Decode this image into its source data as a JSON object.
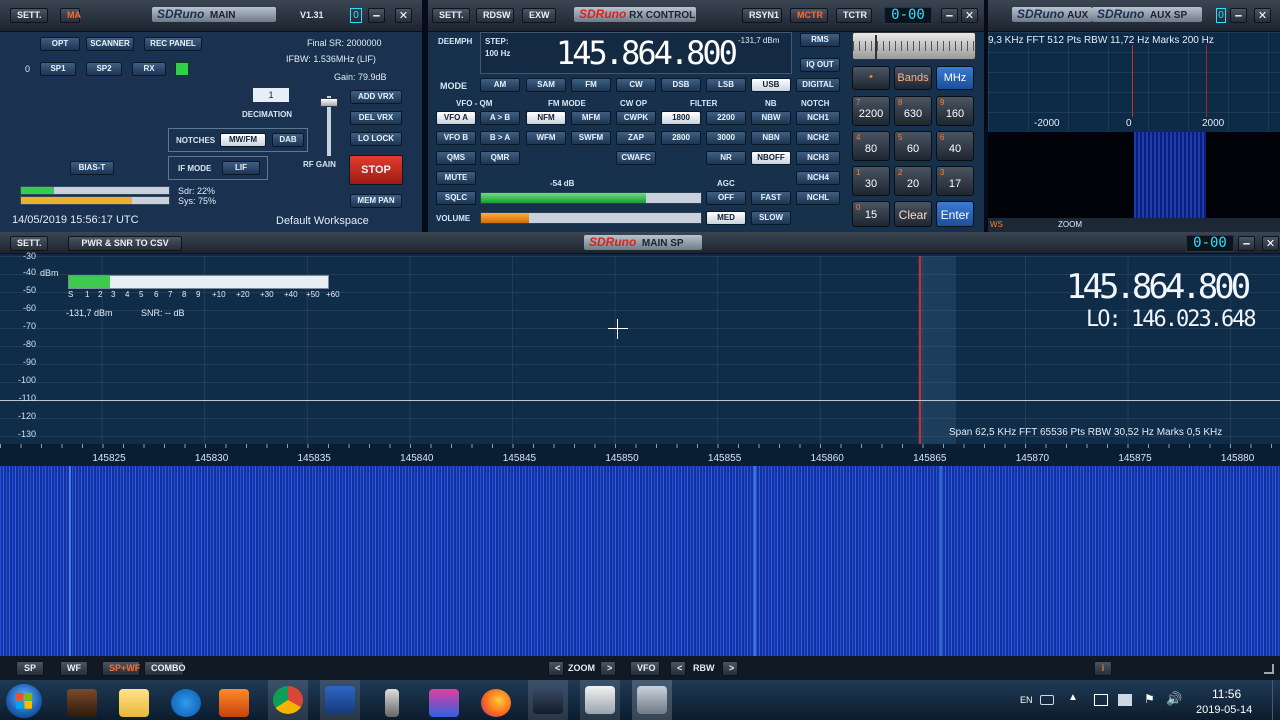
{
  "ma": {
    "sett": "SETT.",
    "ma": "MA",
    "logo": "SDRuno",
    "title": "MAIN",
    "version": "V1.31",
    "buttons": [
      "OPT",
      "SCANNER",
      "REC PANEL"
    ],
    "sp_buttons": [
      "SP1",
      "SP2",
      "RX"
    ],
    "zero": "0",
    "final_sr": "Final SR: 2000000",
    "ifbw": "IFBW: 1.536MHz (LIF)",
    "gain": "Gain: 79.9dB",
    "decimation_value": "1",
    "decimation_label": "DECIMATION",
    "notches": "NOTCHES",
    "mwfm": "MW/FM",
    "dab": "DAB",
    "bias": "BIAS-T",
    "if_mode": "IF MODE",
    "lif": "LIF",
    "rf_gain": "RF GAIN",
    "add_vrx": "ADD VRX",
    "del_vrx": "DEL VRX",
    "lo_lock": "LO LOCK",
    "stop": "STOP",
    "mem_pan": "MEM PAN",
    "sdr": "Sdr: 22%",
    "sys": "Sys: 75%",
    "datetime": "14/05/2019 15:56:17 UTC",
    "workspace": "Default Workspace"
  },
  "rx": {
    "sett": "SETT.",
    "rdsw": "RDSW",
    "exw": "EXW",
    "logo": "SDRuno",
    "title": "RX CONTROL",
    "rsyn": "RSYN1",
    "mctr": "MCTR",
    "tctr": "TCTR",
    "lcd": "0-00",
    "deemph": "DEEMPH",
    "step_label": "STEP:",
    "step_value": "100 Hz",
    "frequency": "145.864.800",
    "level": "-131,7 dBm",
    "rms": "RMS",
    "iq_out": "IQ OUT",
    "mode_label": "MODE",
    "modes": [
      "AM",
      "SAM",
      "FM",
      "CW",
      "DSB",
      "LSB",
      "USB",
      "DIGITAL"
    ],
    "vfo_qm": "VFO - QM",
    "fm_mode": "FM MODE",
    "cw_op": "CW OP",
    "filter": "FILTER",
    "nb": "NB",
    "notch": "NOTCH",
    "row1": [
      "VFO A",
      "A > B",
      "NFM",
      "MFM",
      "CWPK",
      "1800",
      "2200",
      "NBW",
      "NCH1"
    ],
    "row2": [
      "VFO B",
      "B > A",
      "WFM",
      "SWFM",
      "ZAP",
      "2800",
      "3000",
      "NBN",
      "NCH2"
    ],
    "row3": [
      "QMS",
      "QMR",
      "CWAFC",
      "NR",
      "NBOFF",
      "NCH3"
    ],
    "mute": "MUTE",
    "nch4": "NCH4",
    "sqlc": "SQLC",
    "volume": "VOLUME",
    "sql_db": "-54 dB",
    "agc": "AGC",
    "agc_buttons": [
      "OFF",
      "FAST",
      "MED",
      "SLOW"
    ],
    "nchl": "NCHL",
    "sql_level": 0.75,
    "volume_level": 0.22
  },
  "keypad": {
    "bands": "Bands",
    "mhz": "MHz",
    "keys": [
      {
        "n": "7",
        "v": "2200"
      },
      {
        "n": "8",
        "v": "630"
      },
      {
        "n": "9",
        "v": "160"
      },
      {
        "n": "4",
        "v": "80"
      },
      {
        "n": "5",
        "v": "60"
      },
      {
        "n": "6",
        "v": "40"
      },
      {
        "n": "1",
        "v": "30"
      },
      {
        "n": "2",
        "v": "20"
      },
      {
        "n": "3",
        "v": "17"
      },
      {
        "n": "0",
        "v": "15"
      }
    ],
    "clear": "Clear",
    "enter": "Enter"
  },
  "aux": {
    "logo1": "SDRuno",
    "aux1": "AUX",
    "logo2": "SDRuno",
    "title": "AUX SP",
    "info": "9,3 KHz  FFT 512 Pts  RBW 11,72 Hz  Marks 200 Hz",
    "ticks": [
      "-2000",
      "0",
      "2000"
    ],
    "zoom": "ZOOM",
    "ws": "WS"
  },
  "main_sp": {
    "sett": "SETT.",
    "csv": "PWR & SNR TO CSV",
    "logo": "SDRuno",
    "title": "MAIN SP",
    "lcd": "0-00",
    "dbm_unit": "dBm",
    "y_ticks": [
      "-40",
      "-50",
      "-60",
      "-70",
      "-80",
      "-90",
      "-100",
      "-110",
      "-120",
      "-130"
    ],
    "top_tick": "-30",
    "smeter_scale": [
      "S",
      "1",
      "2",
      "3",
      "4",
      "5",
      "6",
      "7",
      "8",
      "9",
      "+10",
      "+20",
      "+30",
      "+40",
      "+50",
      "+60"
    ],
    "smeter_level": "-131,7 dBm",
    "snr": "SNR: -- dB",
    "big_freq": "145.864.800",
    "lo": "LO: 146.023.648",
    "span_info": "Span 62,5 KHz  FFT 65536 Pts  RBW 30,52 Hz  Marks 0,5 KHz",
    "x_ticks": [
      "145825",
      "145830",
      "145835",
      "145840",
      "145845",
      "145850",
      "145855",
      "145860",
      "145865",
      "145870",
      "145875",
      "145880"
    ]
  },
  "bottom": {
    "sp": "SP",
    "wf": "WF",
    "spwf": "SP+WF",
    "combo": "COMBO",
    "zoom": "ZOOM",
    "vfo": "VFO",
    "rbw": "RBW"
  },
  "taskbar": {
    "lang": "EN",
    "time": "11:56",
    "date": "2019-05-14"
  }
}
